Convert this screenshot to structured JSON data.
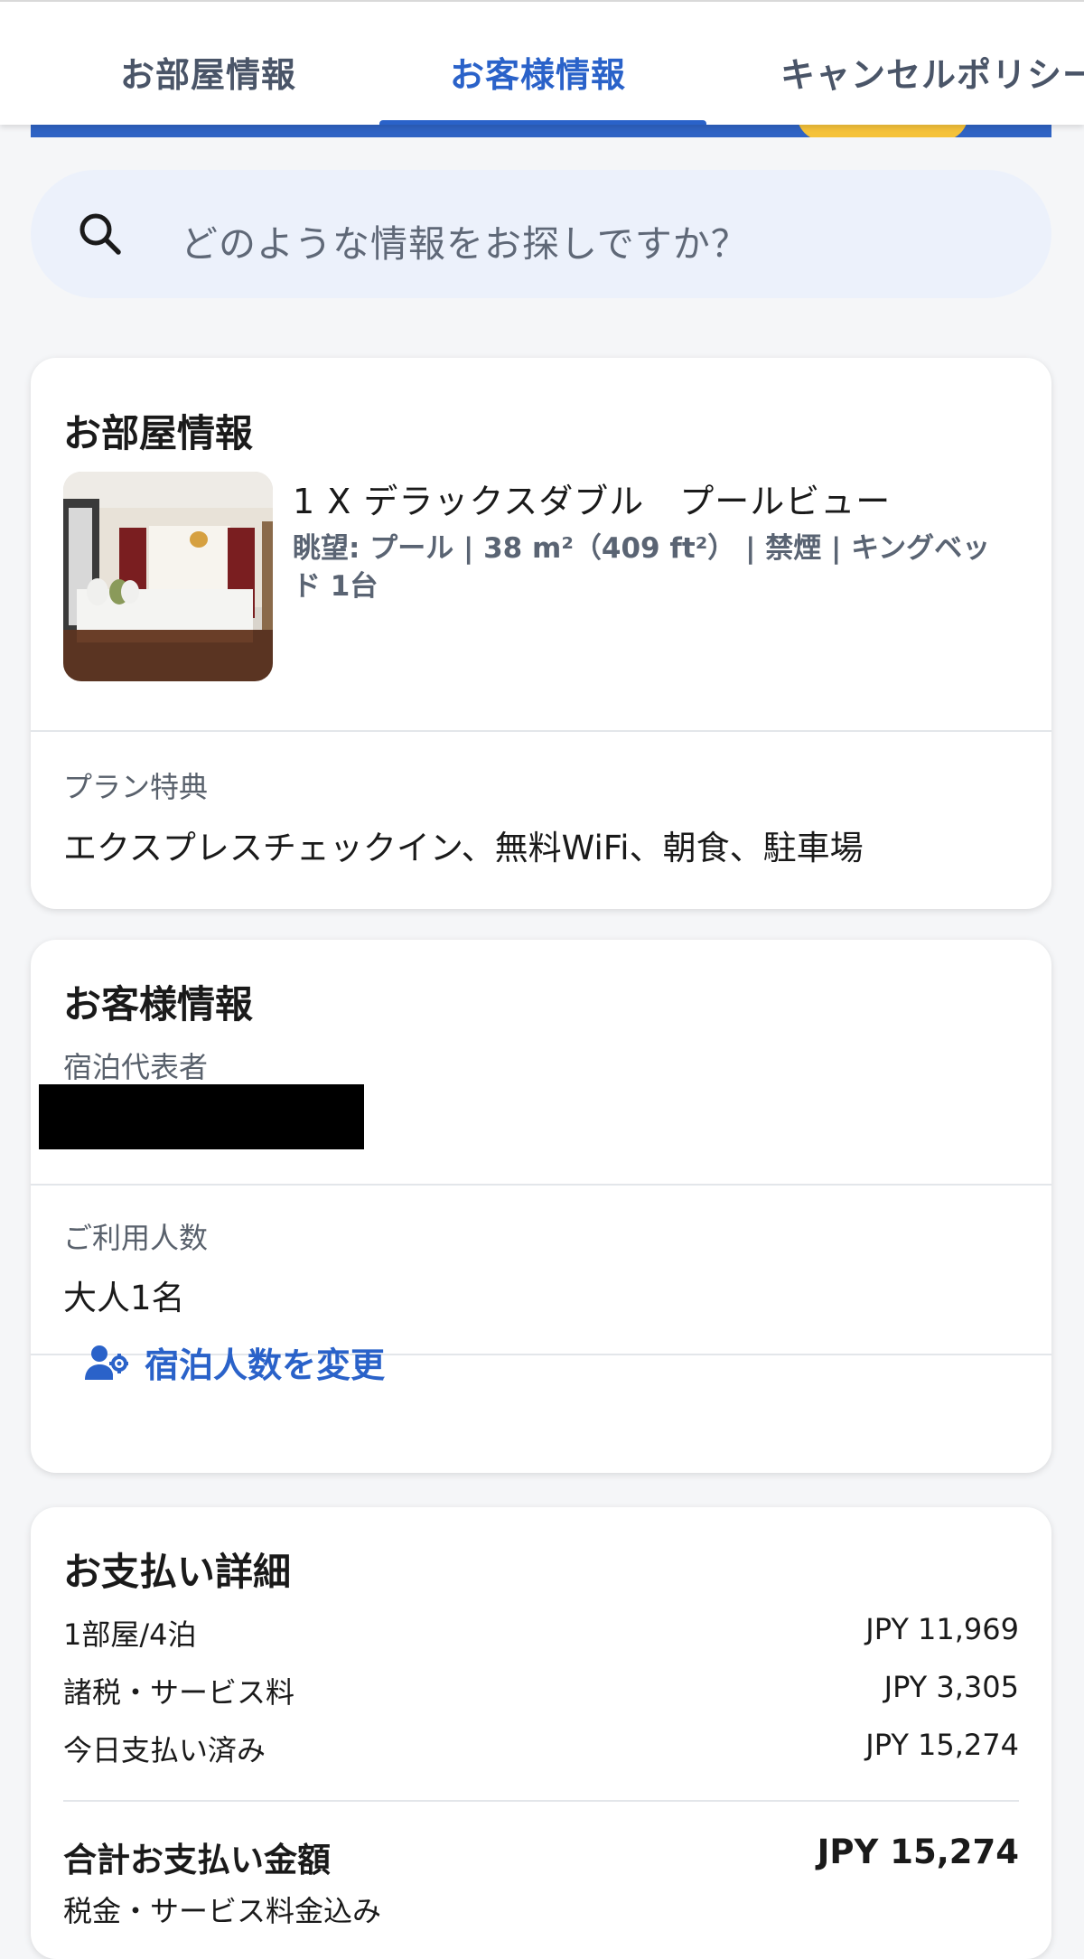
{
  "tabs": [
    {
      "label": "お部屋情報",
      "active": false
    },
    {
      "label": "お客様情報",
      "active": true
    },
    {
      "label": "キャンセルポリシー",
      "active": false
    }
  ],
  "search": {
    "placeholder": "どのような情報をお探しですか？",
    "icon": "search-icon"
  },
  "room_card": {
    "title": "お部屋情報",
    "room_name": "1 X デラックスダブル　プールビュー",
    "room_details": "眺望: プール | 38 m²（409 ft²） | 禁煙 | キングベッド 1台",
    "plan_label": "プラン特典",
    "plan_value": "エクスプレスチェックイン、無料WiFi、朝食、駐車場"
  },
  "guest_card": {
    "title": "お客様情報",
    "representative_label": "宿泊代表者",
    "guests_label": "ご利用人数",
    "guests_value": "大人1名",
    "change_link": "宿泊人数を変更",
    "change_icon": "user-gear-icon"
  },
  "payment_card": {
    "title": "お支払い詳細",
    "rows": [
      {
        "label": "1部屋/4泊",
        "amount": "JPY 11,969"
      },
      {
        "label": "諸税・サービス料",
        "amount": "JPY 3,305"
      },
      {
        "label": "今日支払い済み",
        "amount": "JPY 15,274"
      }
    ],
    "total_label": "合計お支払い金額",
    "total_amount": "JPY 15,274",
    "total_note": "税金・サービス料金込み"
  },
  "colors": {
    "accent": "#2a62c9",
    "search_bg": "#ecf1fb",
    "page_bg": "#f5f6f8"
  }
}
